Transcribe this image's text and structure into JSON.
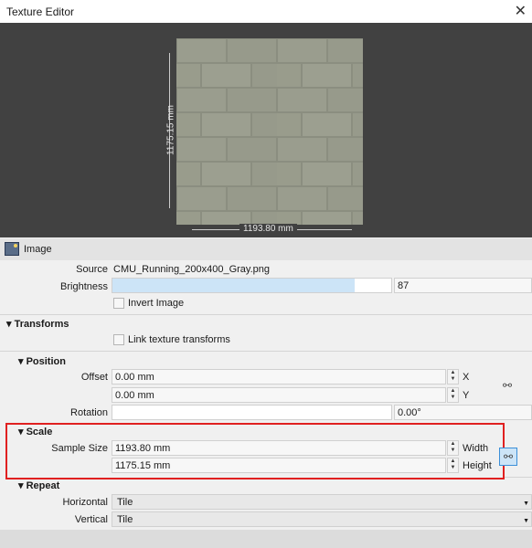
{
  "window": {
    "title": "Texture Editor",
    "close_icon": "close-icon"
  },
  "preview": {
    "width_dim": "1193.80 mm",
    "height_dim": "1175.15 mm"
  },
  "image": {
    "header": "Image",
    "source_label": "Source",
    "source_value": "CMU_Running_200x400_Gray.png",
    "brightness_label": "Brightness",
    "brightness_value": "87",
    "brightness_fraction": 0.87,
    "invert_label": "Invert Image",
    "invert_checked": false
  },
  "transforms": {
    "header": "Transforms",
    "link_label": "Link texture transforms",
    "link_checked": false
  },
  "position": {
    "header": "Position",
    "offset_label": "Offset",
    "offset_x": "0.00 mm",
    "x_label": "X",
    "offset_y": "0.00 mm",
    "y_label": "Y",
    "rotation_label": "Rotation",
    "rotation_value": "0.00°"
  },
  "scale": {
    "header": "Scale",
    "sample_size_label": "Sample Size",
    "width_value": "1193.80 mm",
    "width_label": "Width",
    "height_value": "1175.15 mm",
    "height_label": "Height",
    "linked": true,
    "highlight_color": "#e02020"
  },
  "repeat": {
    "header": "Repeat",
    "horizontal_label": "Horizontal",
    "horizontal_value": "Tile",
    "vertical_label": "Vertical",
    "vertical_value": "Tile"
  }
}
